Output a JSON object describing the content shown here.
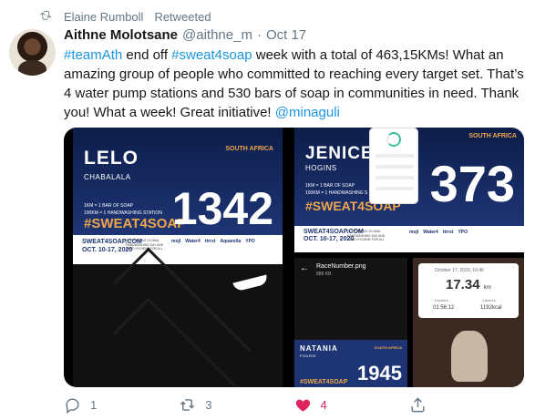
{
  "retweet_context": {
    "label": "Elaine Rumboll",
    "verb": "Retweeted"
  },
  "tweet": {
    "author_name": "Aithne Molotsane",
    "handle": "@aithne_m",
    "separator": "·",
    "date": "Oct 17",
    "hashtag_team": "#teamAth",
    "text_part1": " end off ",
    "hashtag_sweat": "#sweat4soap",
    "text_part2": " week with a total of 463,15KMs! What an amazing group of people who committed to reaching every target set. That’s 4 water pump stations and 530 bars of soap in communities in need. Thank you! What a week! Great initiative! ",
    "mention": "@minaguli"
  },
  "media": {
    "card1": {
      "first_name": "LELO",
      "surname": "CHABALALA",
      "country": "SOUTH AFRICA",
      "line1": "1KM = 1 BAR OF SOAP",
      "line2": "100KM = 1 HANDWASHING STATION",
      "tag": "#SWEAT4SOAP",
      "number": "1342",
      "site": "SWEAT4SOAP.COM",
      "dates": "OCT. 10-17, 2020",
      "blurb": "SUPPORTING GLOBAL HANDWASHING DAY AND HAND HYGIENE FOR ALL",
      "sponsors": [
        "mojl",
        "Water4",
        "ttrrst",
        "Aquarella",
        "YPO"
      ]
    },
    "card2": {
      "first_name": "JENICE",
      "surname": "HOGINS",
      "country": "SOUTH AFRICA",
      "line1": "1KM = 1 BAR OF SOAP",
      "line2": "100KM = 1 HANDWASHING S",
      "tag": "#SWEAT4SOAP",
      "number": "373",
      "site": "SWEAT4SOAP.COM",
      "dates": "OCT. 10-17, 2020",
      "blurb": "SUPPORTING GLOBAL HANDWASHING DAY AND HAND HYGIENE FOR ALL",
      "sponsors": [
        "mojl",
        "Water4",
        "ttrrst",
        "YPO"
      ]
    },
    "card3": {
      "file_name": "RaceNumber.png",
      "file_size": "888 KB",
      "first_name": "NATANIA",
      "surname": "FOURIE",
      "country": "SOUTH AFRICA",
      "tag": "#SWEAT4SOAP",
      "number": "1945"
    },
    "card4": {
      "date": "October 17, 2020, 16:46",
      "distance": "17.34",
      "unit": "km",
      "label1": "Duration",
      "value1": "01:56:12",
      "label2": "Calories",
      "value2": "1192kcal"
    }
  },
  "actions": {
    "reply_count": "1",
    "retweet_count": "3",
    "like_count": "4",
    "accent_like": "#e0245e",
    "accent_link": "#1b95e0"
  }
}
